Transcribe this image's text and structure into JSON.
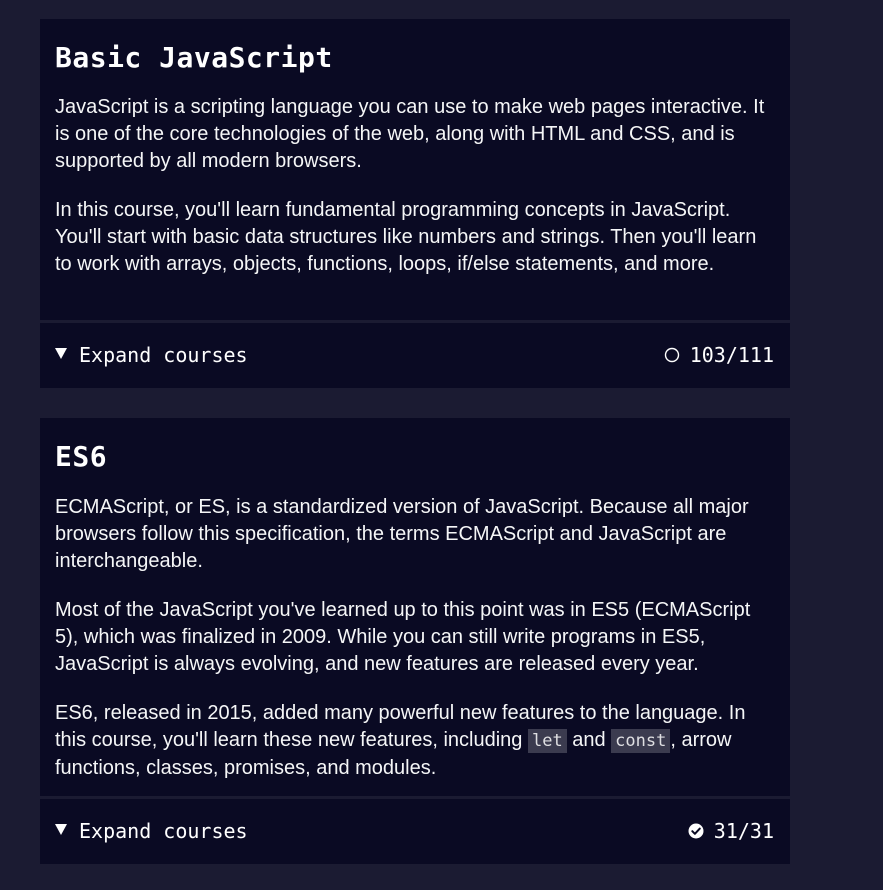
{
  "courses": [
    {
      "title": "Basic JavaScript",
      "paragraphs": [
        "JavaScript is a scripting language you can use to make web pages interactive. It is one of the core technologies of the web, along with HTML and CSS, and is supported by all modern browsers.",
        "In this course, you'll learn fundamental programming concepts in JavaScript. You'll start with basic data structures like numbers and strings. Then you'll learn to work with arrays, objects, functions, loops, if/else statements, and more."
      ],
      "expand_label": "Expand courses",
      "progress": "103/111",
      "status_icon": "incomplete-circle-icon"
    },
    {
      "title": "ES6",
      "paragraphs": [
        "ECMAScript, or ES, is a standardized version of JavaScript. Because all major browsers follow this specification, the terms ECMAScript and JavaScript are interchangeable.",
        "Most of the JavaScript you've learned up to this point was in ES5 (ECMAScript 5), which was finalized in 2009. While you can still write programs in ES5, JavaScript is always evolving, and new features are released every year."
      ],
      "p3": {
        "before": "ES6, released in 2015, added many powerful new features to the language. In this course, you'll learn these new features, including ",
        "code1": "let",
        "middle": " and ",
        "code2": "const",
        "after": ", arrow functions, classes, promises, and modules."
      },
      "expand_label": "Expand courses",
      "progress": "31/31",
      "status_icon": "complete-check-icon"
    }
  ],
  "colors": {
    "page_bg": "#1b1b32",
    "card_bg": "#0a0a23",
    "text": "#f5f6f7",
    "code_bg": "#3b3b4f"
  }
}
